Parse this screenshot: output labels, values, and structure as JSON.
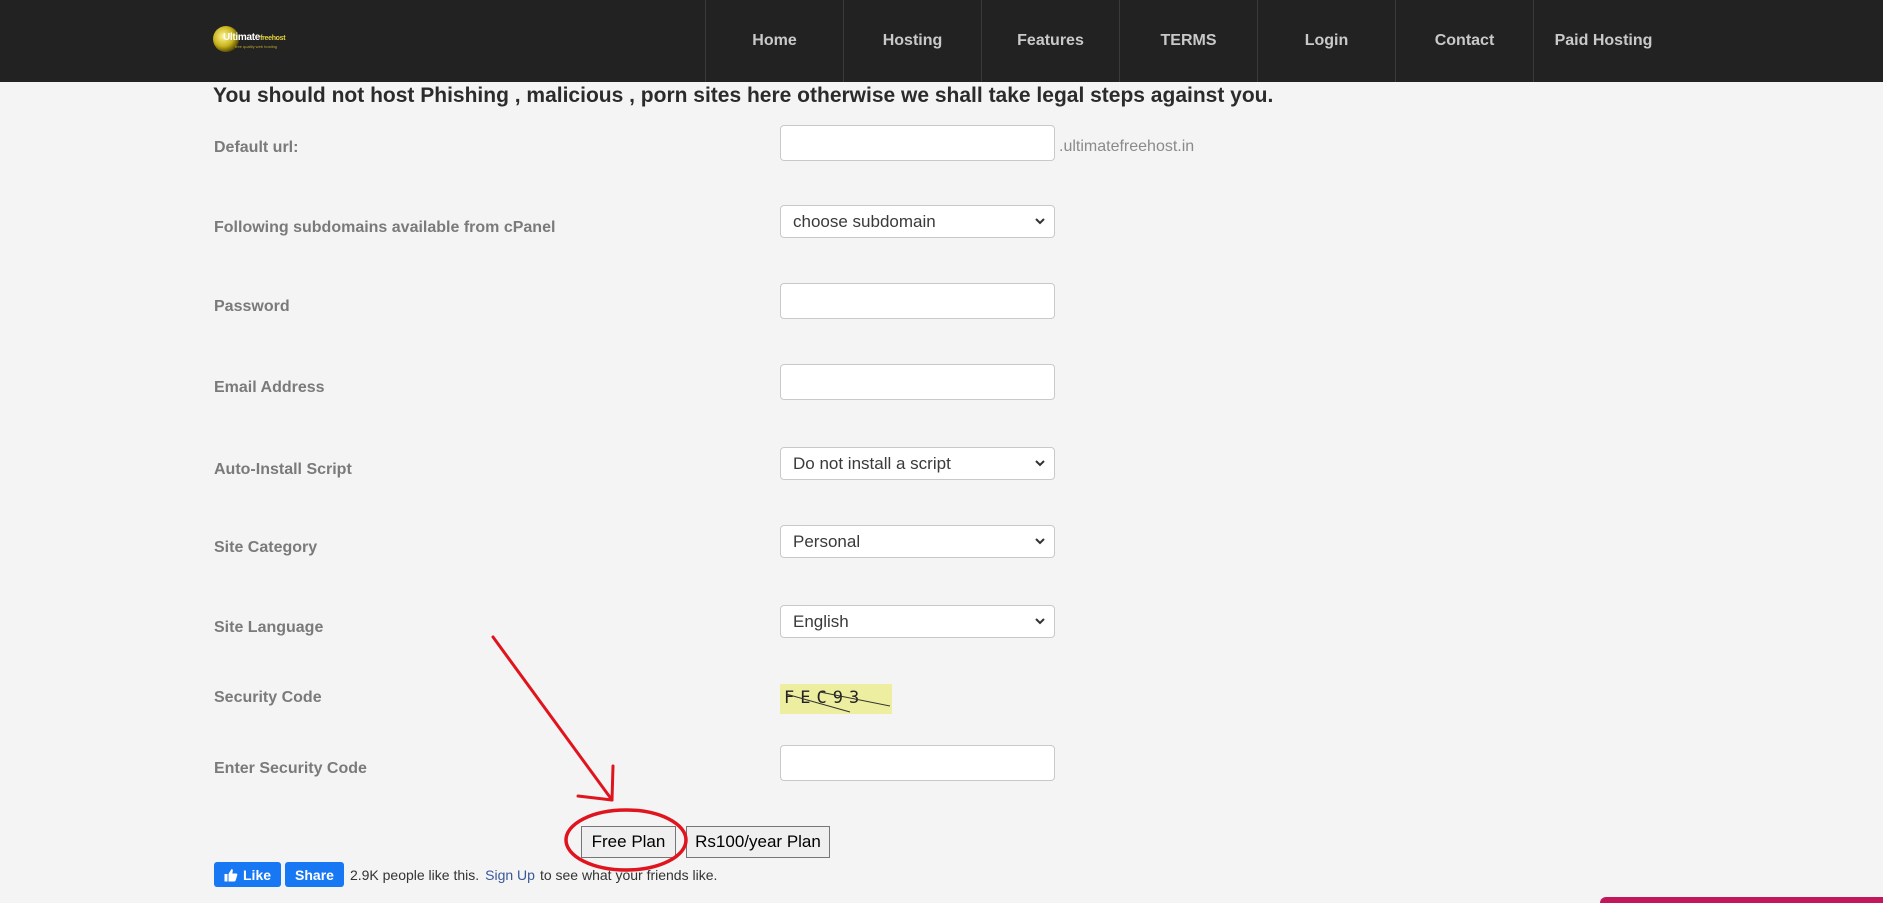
{
  "header": {
    "logo": {
      "brand": "Ultimate",
      "brand_suffix": "freehost",
      "tagline": "free quality web hosting"
    },
    "nav": [
      "Home",
      "Hosting",
      "Features",
      "TERMS",
      "Login",
      "Contact",
      "Paid Hosting"
    ]
  },
  "warning": "You should not host Phishing , malicious , porn sites here otherwise we shall take legal steps against you.",
  "form": {
    "default_url": {
      "label": "Default url:",
      "value": "",
      "suffix": ".ultimatefreehost.in"
    },
    "subdomain": {
      "label": "Following subdomains available from cPanel",
      "selected": "choose subdomain"
    },
    "password": {
      "label": "Password",
      "value": ""
    },
    "email": {
      "label": "Email Address",
      "value": ""
    },
    "auto_install": {
      "label": "Auto-Install Script",
      "selected": "Do not install a script"
    },
    "site_category": {
      "label": "Site Category",
      "selected": "Personal"
    },
    "site_language": {
      "label": "Site Language",
      "selected": "English"
    },
    "security_code": {
      "label": "Security Code",
      "captcha_text": "FEC93"
    },
    "enter_security_code": {
      "label": "Enter Security Code",
      "value": ""
    }
  },
  "buttons": {
    "free_plan": "Free Plan",
    "paid_plan": "Rs100/year Plan"
  },
  "facebook": {
    "like": "Like",
    "share": "Share",
    "count_text": "2.9K people like this.",
    "signup": "Sign Up",
    "signup_suffix": "to see what your friends like."
  },
  "colors": {
    "header_bg": "#222222",
    "page_bg": "#f4f4f4",
    "facebook_blue": "#1877f2",
    "annotation_red": "#e0141e"
  }
}
